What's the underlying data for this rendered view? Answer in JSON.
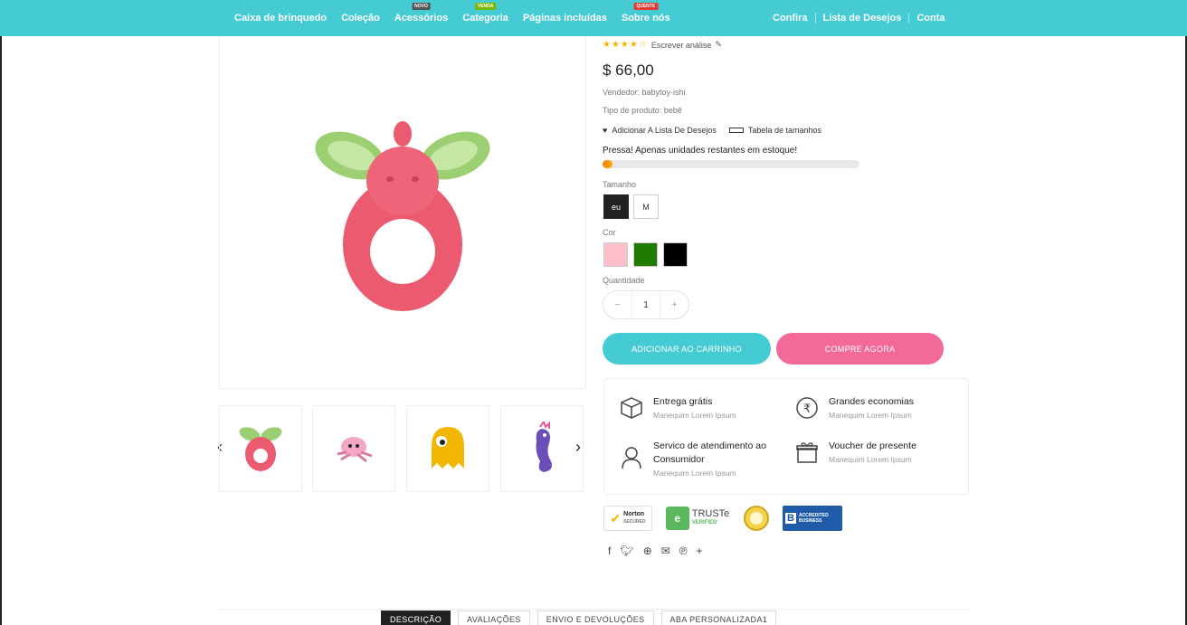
{
  "nav": {
    "left": [
      {
        "label": "Caixa de brinquedo"
      },
      {
        "label": "Coleção"
      },
      {
        "label": "Acessórios",
        "badge": "NOVO",
        "badge_color": "#555555"
      },
      {
        "label": "Categoria",
        "badge": "VENDA",
        "badge_color": "#7ab800"
      },
      {
        "label": "Páginas incluídas"
      },
      {
        "label": "Sobre nós",
        "badge": "QUENTE",
        "badge_color": "#e53935"
      }
    ],
    "right": [
      "Confira",
      "Lista de Desejos",
      "Conta"
    ]
  },
  "product": {
    "rating_stars": 3.5,
    "write_review": "Escrever análise",
    "price": "$ 66,00",
    "vendor": "Vendedor: babytoy-ishi",
    "type": "Tipo de produto: bebê",
    "wishlist_label": "Adicionar A Lista De Desejos",
    "size_chart_label": "Tabela de tamanhos",
    "stock_text": "Pressa! Apenas    unidades restantes em estoque!",
    "stock_progress": 0.04,
    "size_label": "Tamanho",
    "sizes": [
      {
        "label": "eu",
        "active": true
      },
      {
        "label": "M",
        "active": false
      }
    ],
    "color_label": "Cor",
    "colors": [
      "#ffc0cb",
      "#1e7b00",
      "#000000"
    ],
    "quantity_label": "Quantidade",
    "quantity": "1",
    "qty_minus": "−",
    "qty_plus": "+",
    "add_to_cart": "ADICIONAR AO CARRINHO",
    "buy_now": "COMPRE AGORA"
  },
  "features": [
    {
      "title": "Entrega grátis",
      "sub": "Manequim Lorem Ipsum",
      "icon": "box-icon"
    },
    {
      "title": "Grandes economias",
      "sub": "Manequim Lorem Ipsum",
      "icon": "rupee-icon"
    },
    {
      "title": "Servico de atendimento ao Consumidor",
      "sub": "Manequim Lorem Ipsum",
      "icon": "user-icon"
    },
    {
      "title": "Voucher de presente",
      "sub": "Manequim Lorem Ipsum",
      "icon": "gift-icon"
    }
  ],
  "trust": {
    "norton": "Norton",
    "norton_sub": "SECURED",
    "truste": "TRUSTe",
    "truste_sub": "VERIFIED",
    "bbb": "ACCREDITED BUSINESS"
  },
  "social": [
    "f",
    "t",
    "p",
    "e",
    "P",
    "+"
  ],
  "tabs": [
    {
      "label": "DESCRIÇÃO",
      "active": true
    },
    {
      "label": "AVALIAÇÕES",
      "active": false
    },
    {
      "label": "ENVIO E DEVOLUÇÕES",
      "active": false
    },
    {
      "label": "ABA PERSONALIZADA1",
      "active": false
    }
  ],
  "colors": {
    "accent": "#45cbd3",
    "pink": "#f36a9a"
  }
}
